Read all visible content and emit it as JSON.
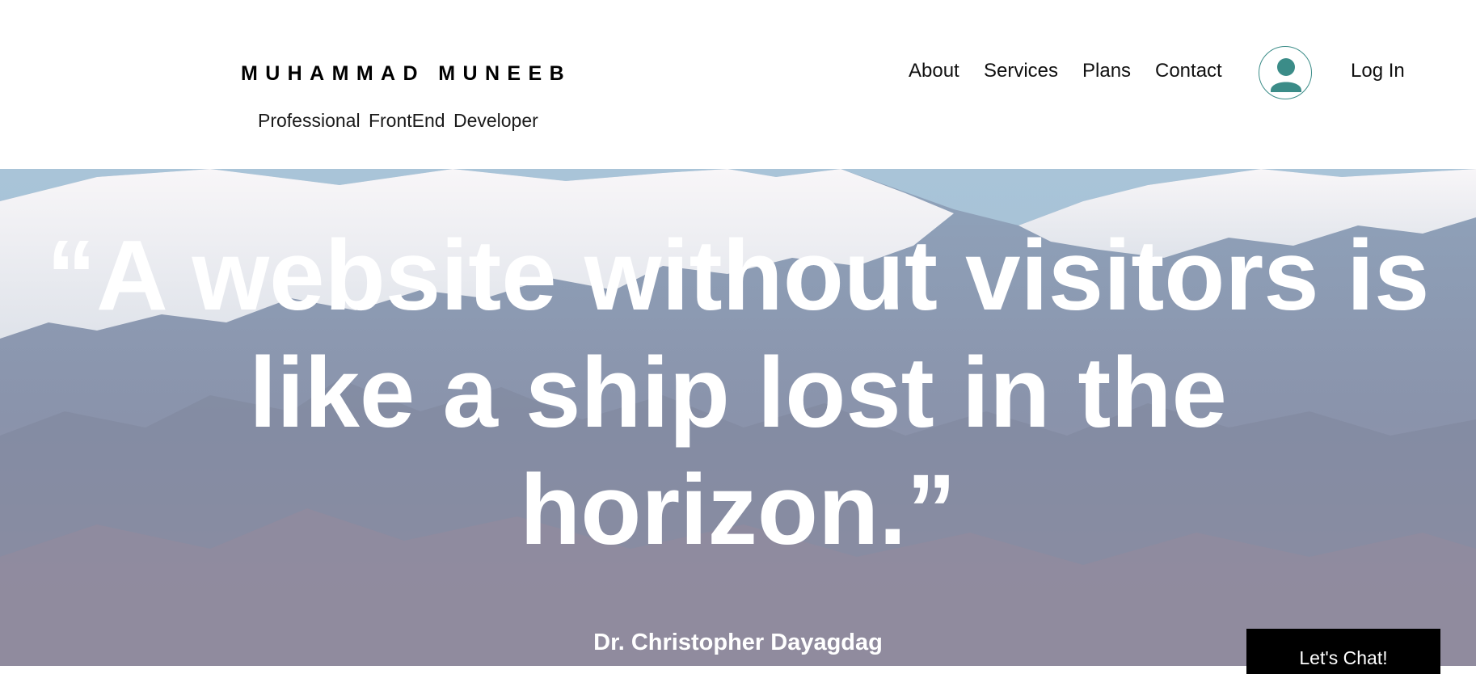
{
  "header": {
    "site_name": "MUHAMMAD MUNEEB",
    "tagline": "Professional FrontEnd Developer",
    "nav": [
      "About",
      "Services",
      "Plans",
      "Contact"
    ],
    "login_label": "Log In",
    "avatar_icon": "user-avatar-icon",
    "accent_color": "#3b8c88"
  },
  "hero": {
    "quote_lines": [
      "“A website without visitors is",
      "like a ship lost in the",
      "horizon.”"
    ],
    "author": "Dr. Christopher Dayagdag",
    "background": "snowy-mountain-range-photo"
  },
  "chat": {
    "label": "Let's Chat!"
  }
}
